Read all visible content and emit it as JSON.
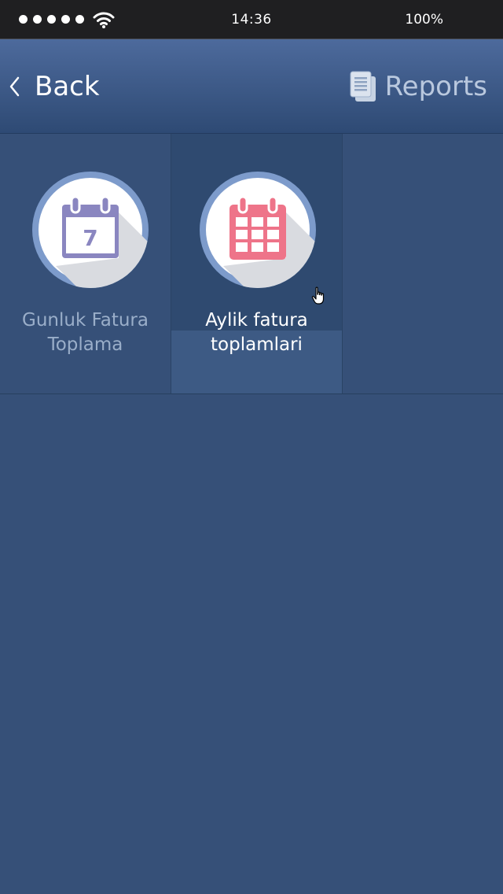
{
  "status_bar": {
    "time": "14:36",
    "battery": "100%",
    "signal_dots": 5,
    "icons": [
      "signal-dots-icon",
      "wifi-icon"
    ]
  },
  "nav": {
    "back_label": "Back",
    "title": "Reports",
    "icons": [
      "chevron-left-icon",
      "document-icon"
    ]
  },
  "tiles": [
    {
      "label_line1": "Gunluk Fatura",
      "label_line2": "Toplama",
      "icon": "calendar-day-icon",
      "icon_number": "7",
      "icon_color": "#8a86c0"
    },
    {
      "label_line1": "Aylik fatura",
      "label_line2": "toplamlari",
      "icon": "calendar-month-icon",
      "icon_color": "#ee7489"
    }
  ],
  "colors": {
    "background": "#365078",
    "nav_gradient_top": "#4d6a9c",
    "nav_gradient_bottom": "#2e4a74",
    "circle_ring": "#7d9bcb"
  }
}
